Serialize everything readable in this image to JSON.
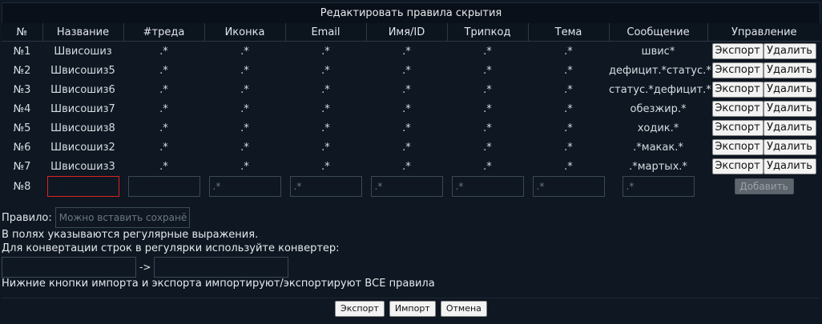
{
  "title": "Редактировать правила скрытия",
  "columns": [
    "№",
    "Название",
    "#треда",
    "Иконка",
    "Email",
    "Имя/ID",
    "Трипкод",
    "Тема",
    "Сообщение",
    "Управление"
  ],
  "rows": [
    {
      "num": "№1",
      "name": "Швисошиз",
      "thread": ".*",
      "icon": ".*",
      "email": ".*",
      "nameid": ".*",
      "trip": ".*",
      "subject": ".*",
      "message": "швис*"
    },
    {
      "num": "№2",
      "name": "Швисошиз5",
      "thread": ".*",
      "icon": ".*",
      "email": ".*",
      "nameid": ".*",
      "trip": ".*",
      "subject": ".*",
      "message": "дефицит.*статус.*"
    },
    {
      "num": "№3",
      "name": "Швисошиз6",
      "thread": ".*",
      "icon": ".*",
      "email": ".*",
      "nameid": ".*",
      "trip": ".*",
      "subject": ".*",
      "message": "статус.*дефицит.*"
    },
    {
      "num": "№4",
      "name": "Швисошиз7",
      "thread": ".*",
      "icon": ".*",
      "email": ".*",
      "nameid": ".*",
      "trip": ".*",
      "subject": ".*",
      "message": "обезжир.*"
    },
    {
      "num": "№5",
      "name": "Швисошиз8",
      "thread": ".*",
      "icon": ".*",
      "email": ".*",
      "nameid": ".*",
      "trip": ".*",
      "subject": ".*",
      "message": "ходик.*"
    },
    {
      "num": "№6",
      "name": "Швисошиз2",
      "thread": ".*",
      "icon": ".*",
      "email": ".*",
      "nameid": ".*",
      "trip": ".*",
      "subject": ".*",
      "message": ".*макак.*"
    },
    {
      "num": "№7",
      "name": "Швисошиз3",
      "thread": ".*",
      "icon": ".*",
      "email": ".*",
      "nameid": ".*",
      "trip": ".*",
      "subject": ".*",
      "message": ".*мартых.*"
    }
  ],
  "row_buttons": {
    "export": "Экспорт",
    "delete": "Удалить"
  },
  "new_rule": {
    "num": "№8",
    "name_value": "",
    "thread_value": "",
    "icon_placeholder": ".*",
    "email_placeholder": ".*",
    "nameid_placeholder": ".*",
    "trip_placeholder": ".*",
    "subject_placeholder": ".*",
    "message_placeholder": ".*",
    "add_label": "Добавить"
  },
  "rule_field": {
    "label": "Правило:",
    "placeholder": "Можно вставить сохранё"
  },
  "info_lines": {
    "line1": "В полях указываются регулярные выражения.",
    "line2": "Для конвертации строк в регулярки используйте конвертер:",
    "line3": "Нижние кнопки импорта и экспорта импортируют/экспортируют ВСЕ правила"
  },
  "converter": {
    "arrow": "->",
    "input_value": "",
    "output_value": ""
  },
  "footer": {
    "export": "Экспорт",
    "import": "Импорт",
    "cancel": "Отмена"
  }
}
